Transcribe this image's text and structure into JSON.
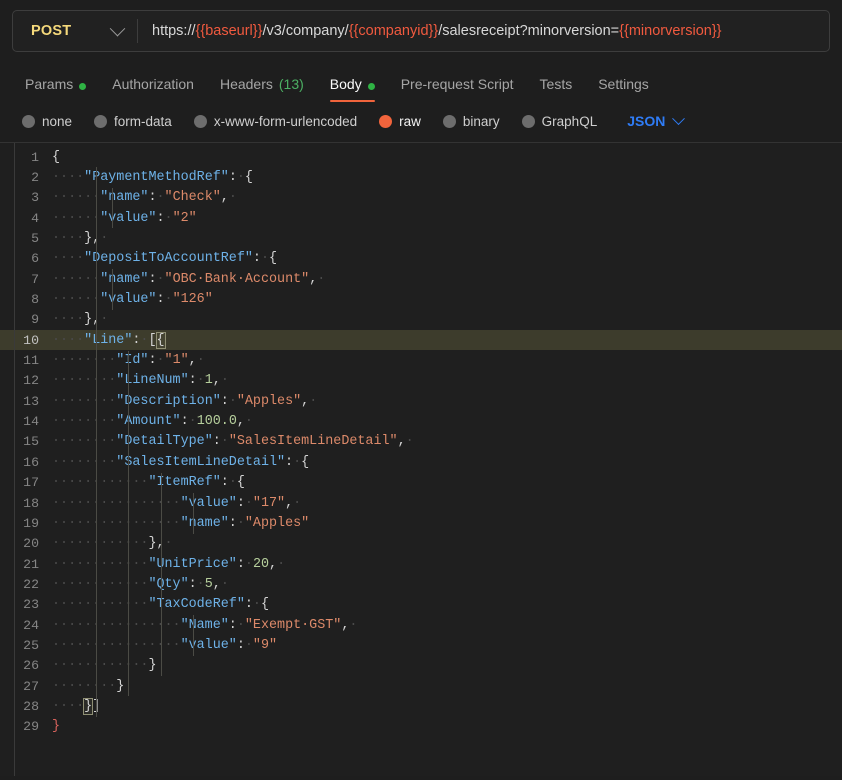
{
  "request": {
    "method": "POST",
    "method_dropdown_icon": "chevron-down-icon",
    "url_segments": [
      {
        "text": "https://",
        "kind": "plain"
      },
      {
        "text": "{{baseurl}}",
        "kind": "var"
      },
      {
        "text": "/v3/company/",
        "kind": "plain"
      },
      {
        "text": "{{companyid}}",
        "kind": "var"
      },
      {
        "text": "/salesreceipt?minorversion=",
        "kind": "plain"
      },
      {
        "text": "{{minorversion}}",
        "kind": "var"
      }
    ],
    "url_full": "https://{{baseurl}}/v3/company/{{companyid}}/salesreceipt?minorversion={{minorversion}}"
  },
  "tabs": [
    {
      "label": "Params",
      "active": false,
      "dot": true,
      "count": ""
    },
    {
      "label": "Authorization",
      "active": false,
      "dot": false,
      "count": ""
    },
    {
      "label": "Headers",
      "active": false,
      "dot": false,
      "count": "(13)"
    },
    {
      "label": "Body",
      "active": true,
      "dot": true,
      "count": ""
    },
    {
      "label": "Pre-request Script",
      "active": false,
      "dot": false,
      "count": ""
    },
    {
      "label": "Tests",
      "active": false,
      "dot": false,
      "count": ""
    },
    {
      "label": "Settings",
      "active": false,
      "dot": false,
      "count": ""
    }
  ],
  "body_types": [
    {
      "label": "none",
      "selected": false
    },
    {
      "label": "form-data",
      "selected": false
    },
    {
      "label": "x-www-form-urlencoded",
      "selected": false
    },
    {
      "label": "raw",
      "selected": true
    },
    {
      "label": "binary",
      "selected": false
    },
    {
      "label": "GraphQL",
      "selected": false
    }
  ],
  "format_select": {
    "label": "JSON",
    "icon": "chevron-down-icon"
  },
  "colors": {
    "accent_orange": "#f1643c",
    "method_yellow": "#f5d97b",
    "json_blue": "#2f7cf6",
    "dot_green": "#2fb344",
    "editor_bg": "#1f1f1f",
    "app_bg": "#1e1e1e",
    "string_salmon": "#dd8a6a",
    "key_blue": "#6eb2e8",
    "number_green": "#b6cf9c",
    "active_line": "#3d3c2c"
  },
  "editor": {
    "language": "json",
    "active_line_number": 10,
    "total_lines": 29,
    "raw_body": "{\n    \"PaymentMethodRef\": {\n      \"name\": \"Check\", \n      \"value\": \"2\"\n    },\n    \"DepositToAccountRef\": {\n      \"name\": \"OBC Bank Account\", \n      \"value\": \"126\"\n    }, \n    \"Line\": [{\n        \"Id\": \"1\", \n        \"LineNum\": 1, \n        \"Description\": \"Apples\", \n        \"Amount\": 100.0, \n        \"DetailType\": \"SalesItemLineDetail\", \n        \"SalesItemLineDetail\": {\n            \"ItemRef\": {\n                \"value\": \"17\", \n                \"name\": \"Apples\"\n            }, \n            \"UnitPrice\": 20, \n            \"Qty\": 5, \n            \"TaxCodeRef\": {\n                \"Name\": \"Exempt GST\", \n                \"value\": \"9\"\n            }\n        }\n    }]\n}",
    "lines": [
      {
        "num": 1,
        "indent": 0,
        "tokens": [
          {
            "t": "{",
            "c": "p"
          }
        ]
      },
      {
        "num": 2,
        "indent": 4,
        "tokens": [
          {
            "t": "\"PaymentMethodRef\"",
            "c": "k"
          },
          {
            "t": ":",
            "c": "p"
          },
          {
            "t": "·",
            "c": "ws"
          },
          {
            "t": "{",
            "c": "p"
          }
        ]
      },
      {
        "num": 3,
        "indent": 6,
        "tokens": [
          {
            "t": "\"name\"",
            "c": "k"
          },
          {
            "t": ":",
            "c": "p"
          },
          {
            "t": "·",
            "c": "ws"
          },
          {
            "t": "\"Check\"",
            "c": "s"
          },
          {
            "t": ",",
            "c": "p"
          },
          {
            "t": "·",
            "c": "ws"
          }
        ]
      },
      {
        "num": 4,
        "indent": 6,
        "tokens": [
          {
            "t": "\"value\"",
            "c": "k"
          },
          {
            "t": ":",
            "c": "p"
          },
          {
            "t": "·",
            "c": "ws"
          },
          {
            "t": "\"2\"",
            "c": "s"
          }
        ]
      },
      {
        "num": 5,
        "indent": 4,
        "tokens": [
          {
            "t": "}",
            "c": "p"
          },
          {
            "t": ",",
            "c": "p"
          },
          {
            "t": "·",
            "c": "ws"
          }
        ]
      },
      {
        "num": 6,
        "indent": 4,
        "tokens": [
          {
            "t": "\"DepositToAccountRef\"",
            "c": "k"
          },
          {
            "t": ":",
            "c": "p"
          },
          {
            "t": "·",
            "c": "ws"
          },
          {
            "t": "{",
            "c": "p"
          }
        ]
      },
      {
        "num": 7,
        "indent": 6,
        "tokens": [
          {
            "t": "\"name\"",
            "c": "k"
          },
          {
            "t": ":",
            "c": "p"
          },
          {
            "t": "·",
            "c": "ws"
          },
          {
            "t": "\"OBC·Bank·Account\"",
            "c": "s"
          },
          {
            "t": ",",
            "c": "p"
          },
          {
            "t": "·",
            "c": "ws"
          }
        ]
      },
      {
        "num": 8,
        "indent": 6,
        "tokens": [
          {
            "t": "\"value\"",
            "c": "k"
          },
          {
            "t": ":",
            "c": "p"
          },
          {
            "t": "·",
            "c": "ws"
          },
          {
            "t": "\"126\"",
            "c": "s"
          }
        ]
      },
      {
        "num": 9,
        "indent": 4,
        "tokens": [
          {
            "t": "}",
            "c": "p"
          },
          {
            "t": ",",
            "c": "p"
          },
          {
            "t": "·",
            "c": "ws"
          }
        ]
      },
      {
        "num": 10,
        "indent": 4,
        "tokens": [
          {
            "t": "\"Line\"",
            "c": "k"
          },
          {
            "t": ":",
            "c": "p"
          },
          {
            "t": "·",
            "c": "ws"
          },
          {
            "t": "[",
            "c": "p"
          },
          {
            "t": "{",
            "c": "p brk"
          }
        ]
      },
      {
        "num": 11,
        "indent": 8,
        "tokens": [
          {
            "t": "\"Id\"",
            "c": "k"
          },
          {
            "t": ":",
            "c": "p"
          },
          {
            "t": "·",
            "c": "ws"
          },
          {
            "t": "\"1\"",
            "c": "s"
          },
          {
            "t": ",",
            "c": "p"
          },
          {
            "t": "·",
            "c": "ws"
          }
        ]
      },
      {
        "num": 12,
        "indent": 8,
        "tokens": [
          {
            "t": "\"LineNum\"",
            "c": "k"
          },
          {
            "t": ":",
            "c": "p"
          },
          {
            "t": "·",
            "c": "ws"
          },
          {
            "t": "1",
            "c": "n"
          },
          {
            "t": ",",
            "c": "p"
          },
          {
            "t": "·",
            "c": "ws"
          }
        ]
      },
      {
        "num": 13,
        "indent": 8,
        "tokens": [
          {
            "t": "\"Description\"",
            "c": "k"
          },
          {
            "t": ":",
            "c": "p"
          },
          {
            "t": "·",
            "c": "ws"
          },
          {
            "t": "\"Apples\"",
            "c": "s"
          },
          {
            "t": ",",
            "c": "p"
          },
          {
            "t": "·",
            "c": "ws"
          }
        ]
      },
      {
        "num": 14,
        "indent": 8,
        "tokens": [
          {
            "t": "\"Amount\"",
            "c": "k"
          },
          {
            "t": ":",
            "c": "p"
          },
          {
            "t": "·",
            "c": "ws"
          },
          {
            "t": "100.0",
            "c": "n"
          },
          {
            "t": ",",
            "c": "p"
          },
          {
            "t": "·",
            "c": "ws"
          }
        ]
      },
      {
        "num": 15,
        "indent": 8,
        "tokens": [
          {
            "t": "\"DetailType\"",
            "c": "k"
          },
          {
            "t": ":",
            "c": "p"
          },
          {
            "t": "·",
            "c": "ws"
          },
          {
            "t": "\"SalesItemLineDetail\"",
            "c": "s"
          },
          {
            "t": ",",
            "c": "p"
          },
          {
            "t": "·",
            "c": "ws"
          }
        ]
      },
      {
        "num": 16,
        "indent": 8,
        "tokens": [
          {
            "t": "\"SalesItemLineDetail\"",
            "c": "k"
          },
          {
            "t": ":",
            "c": "p"
          },
          {
            "t": "·",
            "c": "ws"
          },
          {
            "t": "{",
            "c": "p"
          }
        ]
      },
      {
        "num": 17,
        "indent": 12,
        "tokens": [
          {
            "t": "\"ItemRef\"",
            "c": "k"
          },
          {
            "t": ":",
            "c": "p"
          },
          {
            "t": "·",
            "c": "ws"
          },
          {
            "t": "{",
            "c": "p"
          }
        ]
      },
      {
        "num": 18,
        "indent": 16,
        "tokens": [
          {
            "t": "\"value\"",
            "c": "k"
          },
          {
            "t": ":",
            "c": "p"
          },
          {
            "t": "·",
            "c": "ws"
          },
          {
            "t": "\"17\"",
            "c": "s"
          },
          {
            "t": ",",
            "c": "p"
          },
          {
            "t": "·",
            "c": "ws"
          }
        ]
      },
      {
        "num": 19,
        "indent": 16,
        "tokens": [
          {
            "t": "\"name\"",
            "c": "k"
          },
          {
            "t": ":",
            "c": "p"
          },
          {
            "t": "·",
            "c": "ws"
          },
          {
            "t": "\"Apples\"",
            "c": "s"
          }
        ]
      },
      {
        "num": 20,
        "indent": 12,
        "tokens": [
          {
            "t": "}",
            "c": "p"
          },
          {
            "t": ",",
            "c": "p"
          },
          {
            "t": "·",
            "c": "ws"
          }
        ]
      },
      {
        "num": 21,
        "indent": 12,
        "tokens": [
          {
            "t": "\"UnitPrice\"",
            "c": "k"
          },
          {
            "t": ":",
            "c": "p"
          },
          {
            "t": "·",
            "c": "ws"
          },
          {
            "t": "20",
            "c": "n"
          },
          {
            "t": ",",
            "c": "p"
          },
          {
            "t": "·",
            "c": "ws"
          }
        ]
      },
      {
        "num": 22,
        "indent": 12,
        "tokens": [
          {
            "t": "\"Qty\"",
            "c": "k"
          },
          {
            "t": ":",
            "c": "p"
          },
          {
            "t": "·",
            "c": "ws"
          },
          {
            "t": "5",
            "c": "n"
          },
          {
            "t": ",",
            "c": "p"
          },
          {
            "t": "·",
            "c": "ws"
          }
        ]
      },
      {
        "num": 23,
        "indent": 12,
        "tokens": [
          {
            "t": "\"TaxCodeRef\"",
            "c": "k"
          },
          {
            "t": ":",
            "c": "p"
          },
          {
            "t": "·",
            "c": "ws"
          },
          {
            "t": "{",
            "c": "p"
          }
        ]
      },
      {
        "num": 24,
        "indent": 16,
        "tokens": [
          {
            "t": "\"Name\"",
            "c": "k"
          },
          {
            "t": ":",
            "c": "p"
          },
          {
            "t": "·",
            "c": "ws"
          },
          {
            "t": "\"Exempt·GST\"",
            "c": "s"
          },
          {
            "t": ",",
            "c": "p"
          },
          {
            "t": "·",
            "c": "ws"
          }
        ]
      },
      {
        "num": 25,
        "indent": 16,
        "tokens": [
          {
            "t": "\"value\"",
            "c": "k"
          },
          {
            "t": ":",
            "c": "p"
          },
          {
            "t": "·",
            "c": "ws"
          },
          {
            "t": "\"9\"",
            "c": "s"
          }
        ]
      },
      {
        "num": 26,
        "indent": 12,
        "tokens": [
          {
            "t": "}",
            "c": "p"
          }
        ]
      },
      {
        "num": 27,
        "indent": 8,
        "tokens": [
          {
            "t": "}",
            "c": "p"
          }
        ]
      },
      {
        "num": 28,
        "indent": 4,
        "tokens": [
          {
            "t": "}",
            "c": "p brk"
          },
          {
            "t": "]",
            "c": "p"
          }
        ]
      },
      {
        "num": 29,
        "indent": 0,
        "tokens": [
          {
            "t": "}",
            "c": "bad"
          }
        ]
      }
    ]
  }
}
